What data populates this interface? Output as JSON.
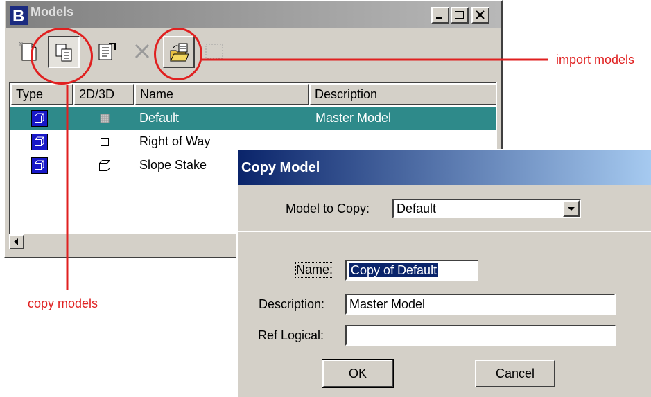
{
  "models_window": {
    "title": "Models",
    "columns": [
      "Type",
      "2D/3D",
      "Name",
      "Description"
    ],
    "rows": [
      {
        "type_icon": "model-type-icon",
        "dim_icon": "2d-shaded-icon",
        "name": "Default",
        "description": "Master Model",
        "selected": true
      },
      {
        "type_icon": "model-type-icon",
        "dim_icon": "2d-square-icon",
        "name": "Right of Way",
        "description": "",
        "selected": false
      },
      {
        "type_icon": "model-type-icon",
        "dim_icon": "3d-cube-icon",
        "name": "Slope Stake",
        "description": "",
        "selected": false
      }
    ],
    "toolbar": [
      "new-model-icon",
      "copy-models-icon",
      "model-properties-icon",
      "delete-model-icon",
      "import-models-icon",
      "blank-tool-icon"
    ]
  },
  "callouts": {
    "import": "import models",
    "copy": "copy models",
    "color": "#e02020"
  },
  "copy_dialog": {
    "title": "Copy Model",
    "model_to_copy_label": "Model to Copy:",
    "model_to_copy_value": "Default",
    "name_label": "Name:",
    "name_value": "Copy of Default",
    "description_label": "Description:",
    "description_value": "Master Model",
    "ref_logical_label": "Ref Logical:",
    "ref_logical_value": "",
    "ok_label": "OK",
    "cancel_label": "Cancel"
  }
}
